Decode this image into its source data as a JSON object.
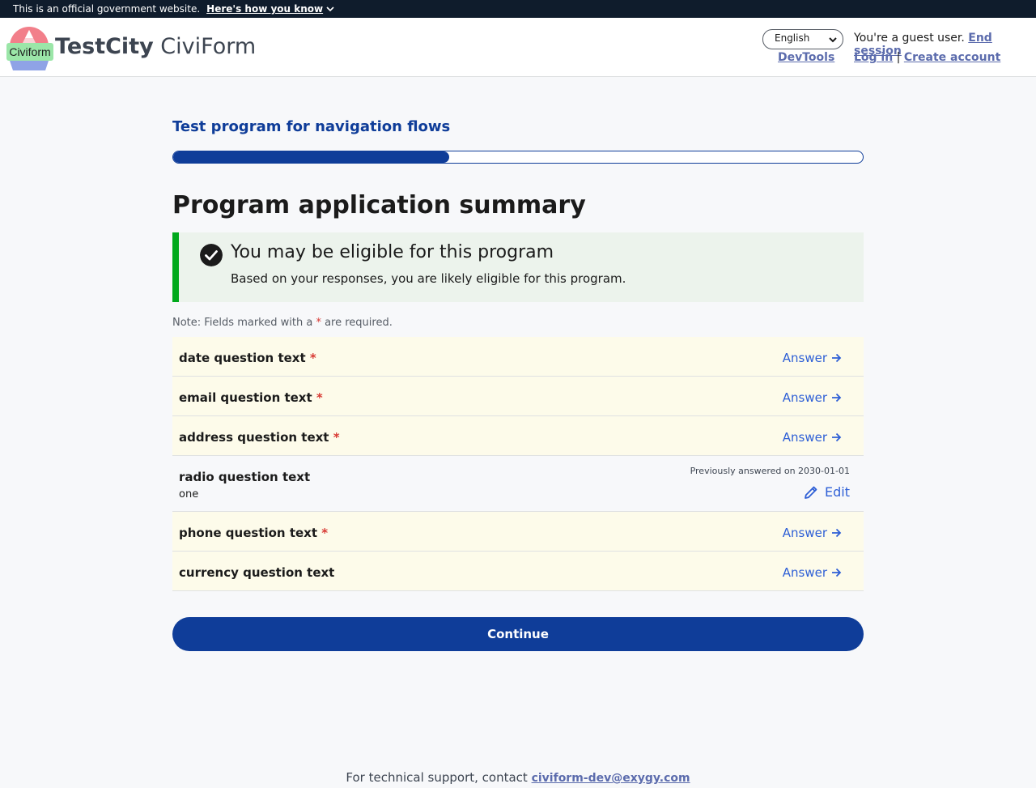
{
  "gov_banner": {
    "text": "This is an official government website.",
    "how_link": "Here's how you know"
  },
  "header": {
    "logo_text": "Civiform",
    "site_title_bold": "TestCity",
    "site_title_rest": " CiviForm",
    "language": "English",
    "devtools": "DevTools",
    "guest_text": "You're a guest user.",
    "end_session": "End session",
    "log_in": "Log in",
    "separator": "|",
    "create_account": "Create account"
  },
  "program": {
    "name": "Test program for navigation flows",
    "progress_fraction": 0.4
  },
  "page_title": "Program application summary",
  "alert": {
    "title": "You may be eligible for this program",
    "body": "Based on your responses, you are likely eligible for this program."
  },
  "note": {
    "prefix": "Note: Fields marked with a",
    "star": "*",
    "suffix": "are required."
  },
  "questions": [
    {
      "text": "date question text",
      "required": "*",
      "action": "Answer"
    },
    {
      "text": "email question text",
      "required": "*",
      "action": "Answer"
    },
    {
      "text": "address question text",
      "required": "*",
      "action": "Answer"
    },
    {
      "text": "radio question text",
      "value": "one",
      "previously": "Previously answered on 2030-01-01",
      "action": "Edit"
    },
    {
      "text": "phone question text",
      "required": "*",
      "action": "Answer"
    },
    {
      "text": "currency question text",
      "action": "Answer"
    }
  ],
  "continue_label": "Continue",
  "footer": {
    "text": "For technical support, contact",
    "email": "civiform-dev@exygy.com"
  },
  "colors": {
    "primary": "#0f3d99",
    "link": "#2e5fd6",
    "success": "#00a91c",
    "required": "#d83933"
  },
  "icons": {
    "alert": "check-circle-icon",
    "answer": "arrow-right-icon",
    "edit": "pencil-icon",
    "banner": "chevron-down-icon"
  }
}
